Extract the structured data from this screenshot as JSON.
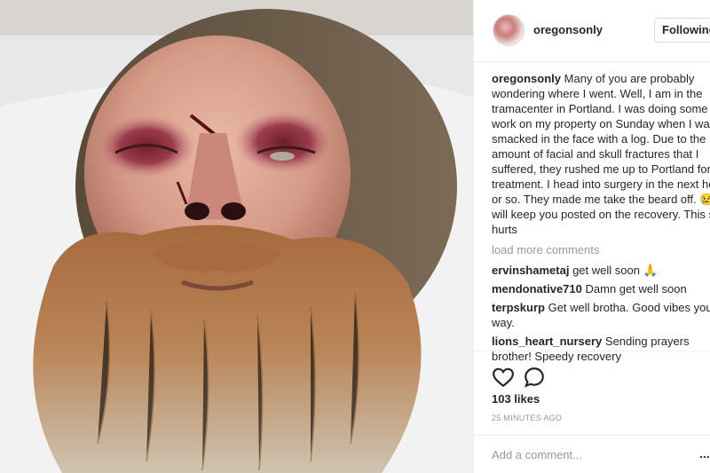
{
  "post": {
    "username": "oregonsonly",
    "follow_label": "Following",
    "caption": "Many of you are probably wondering where I went. Well, I am in the tramacenter in Portland. I was doing some work on my property on Sunday when I was smacked in the face with a log. Due to the amount of facial and skull fractures that I suffered, they rushed me up to Portland for treatment. I head into surgery in the next hour or so. They made me take the beard off. 😢. I will keep you posted on the recovery. This shit hurts",
    "load_more": "load more comments",
    "comments": [
      {
        "user": "ervinshametaj",
        "text": "get well soon 🙏"
      },
      {
        "user": "mendonative710",
        "text": "Damn get well soon"
      },
      {
        "user": "terpskurp",
        "text": "Get well brotha. Good vibes your way."
      },
      {
        "user": "lions_heart_nursery",
        "text": "Sending prayers brother! Speedy recovery"
      }
    ],
    "likes": "103 likes",
    "time": "25 MINUTES AGO",
    "add_comment_placeholder": "Add a comment...",
    "more_label": "..."
  },
  "icons": {
    "like": "heart-icon",
    "comment": "comment-bubble-icon",
    "avatar": "profile-avatar"
  },
  "colors": {
    "text": "#262626",
    "muted": "#999999",
    "border": "#efefef"
  }
}
